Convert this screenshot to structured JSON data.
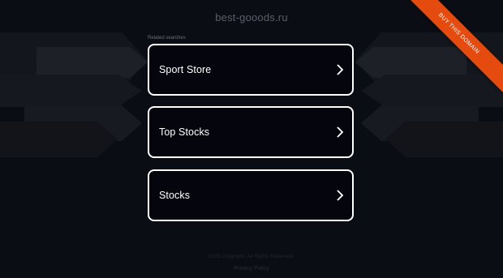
{
  "header": {
    "domain": "best-gooods.ru"
  },
  "ribbon": {
    "label": "BUY THIS DOMAIN",
    "color": "#e54a0f"
  },
  "recent": {
    "label": "Related searches",
    "items": [
      {
        "label": "Sport Store"
      },
      {
        "label": "Top Stocks"
      },
      {
        "label": "Stocks"
      }
    ]
  },
  "footer": {
    "copyright": "2025 Copyright. All Rights Reserved.",
    "privacy": "Privacy Policy"
  },
  "theme": {
    "background": "#0b0d14",
    "card_border": "#ffffff"
  }
}
